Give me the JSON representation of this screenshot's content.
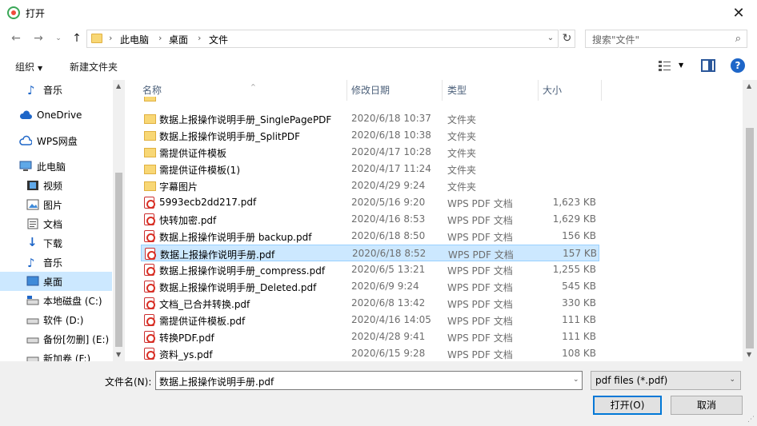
{
  "window": {
    "title": "打开",
    "close": "✕"
  },
  "nav": {
    "breadcrumbs": [
      "此电脑",
      "桌面",
      "文件"
    ],
    "search_placeholder": "搜索\"文件\""
  },
  "toolbar": {
    "organize": "组织",
    "new_folder": "新建文件夹"
  },
  "sidebar": {
    "items": [
      {
        "label": "音乐",
        "icon": "music-note-icon"
      },
      {
        "label": "OneDrive",
        "icon": "cloud-icon"
      },
      {
        "label": "WPS网盘",
        "icon": "wps-cloud-icon"
      },
      {
        "label": "此电脑",
        "icon": "computer-icon"
      },
      {
        "label": "视频",
        "icon": "video-icon"
      },
      {
        "label": "图片",
        "icon": "picture-icon"
      },
      {
        "label": "文档",
        "icon": "document-icon"
      },
      {
        "label": "下载",
        "icon": "download-icon"
      },
      {
        "label": "音乐",
        "icon": "music-note-icon"
      },
      {
        "label": "桌面",
        "icon": "desktop-icon"
      },
      {
        "label": "本地磁盘 (C:)",
        "icon": "drive-icon"
      },
      {
        "label": "软件 (D:)",
        "icon": "drive-icon"
      },
      {
        "label": "备份[勿删] (E:)",
        "icon": "drive-icon"
      },
      {
        "label": "新加卷 (F:)",
        "icon": "drive-icon"
      }
    ]
  },
  "columns": {
    "name": "名称",
    "date": "修改日期",
    "type": "类型",
    "size": "大小"
  },
  "files": [
    {
      "name": "数据上报操作说明手册_SinglePagePDF",
      "date": "2020/6/18 10:37",
      "type": "文件夹",
      "size": "",
      "kind": "folder"
    },
    {
      "name": "数据上报操作说明手册_SplitPDF",
      "date": "2020/6/18 10:38",
      "type": "文件夹",
      "size": "",
      "kind": "folder"
    },
    {
      "name": "需提供证件模板",
      "date": "2020/4/17 10:28",
      "type": "文件夹",
      "size": "",
      "kind": "folder"
    },
    {
      "name": "需提供证件模板(1)",
      "date": "2020/4/17 11:24",
      "type": "文件夹",
      "size": "",
      "kind": "folder"
    },
    {
      "name": "字幕图片",
      "date": "2020/4/29 9:24",
      "type": "文件夹",
      "size": "",
      "kind": "folder"
    },
    {
      "name": "5993ecb2dd217.pdf",
      "date": "2020/5/16 9:20",
      "type": "WPS PDF 文档",
      "size": "1,623 KB",
      "kind": "pdf"
    },
    {
      "name": "快转加密.pdf",
      "date": "2020/4/16 8:53",
      "type": "WPS PDF 文档",
      "size": "1,629 KB",
      "kind": "pdf"
    },
    {
      "name": "数据上报操作说明手册 backup.pdf",
      "date": "2020/6/18 8:50",
      "type": "WPS PDF 文档",
      "size": "156 KB",
      "kind": "pdf"
    },
    {
      "name": "数据上报操作说明手册.pdf",
      "date": "2020/6/18 8:52",
      "type": "WPS PDF 文档",
      "size": "157 KB",
      "kind": "pdf",
      "selected": true
    },
    {
      "name": "数据上报操作说明手册_compress.pdf",
      "date": "2020/6/5 13:21",
      "type": "WPS PDF 文档",
      "size": "1,255 KB",
      "kind": "pdf"
    },
    {
      "name": "数据上报操作说明手册_Deleted.pdf",
      "date": "2020/6/9 9:24",
      "type": "WPS PDF 文档",
      "size": "545 KB",
      "kind": "pdf"
    },
    {
      "name": "文档_已合并转换.pdf",
      "date": "2020/6/8 13:42",
      "type": "WPS PDF 文档",
      "size": "330 KB",
      "kind": "pdf"
    },
    {
      "name": "需提供证件模板.pdf",
      "date": "2020/4/16 14:05",
      "type": "WPS PDF 文档",
      "size": "111 KB",
      "kind": "pdf"
    },
    {
      "name": "转换PDF.pdf",
      "date": "2020/4/28 9:41",
      "type": "WPS PDF 文档",
      "size": "111 KB",
      "kind": "pdf"
    },
    {
      "name": "资料_ys.pdf",
      "date": "2020/6/15 9:28",
      "type": "WPS PDF 文档",
      "size": "108 KB",
      "kind": "pdf"
    }
  ],
  "bottom": {
    "filename_label": "文件名(N):",
    "filename_value": "数据上报操作说明手册.pdf",
    "filter": "pdf files (*.pdf)",
    "open": "打开(O)",
    "cancel": "取消"
  }
}
